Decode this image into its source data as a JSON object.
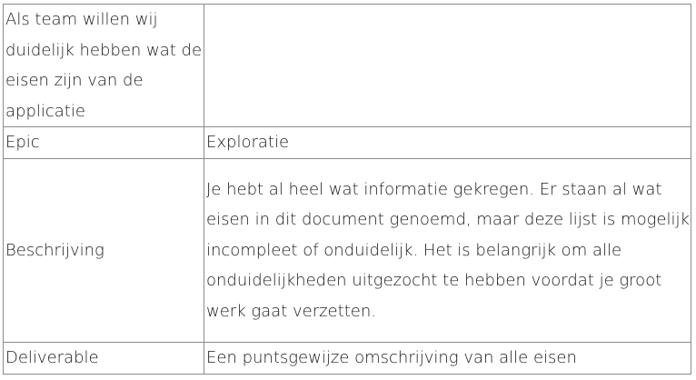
{
  "table": {
    "title_row": {
      "label": "Als team willen wij duidelijk hebben wat de eisen zijn van de applicatie",
      "value": ""
    },
    "epic_row": {
      "label": "Epic",
      "value": "Exploratie"
    },
    "description_row": {
      "label": "Beschrijving",
      "value": "Je hebt al heel wat informatie gekregen. Er staan al wat eisen in dit document genoemd, maar deze lijst is mogelijk incompleet of onduidelijk. Het is belangrijk om alle onduidelijkheden uitgezocht te hebben voordat je groot werk gaat verzetten."
    },
    "deliverable_row": {
      "label": "Deliverable",
      "value": "Een puntsgewijze omschrijving van alle eisen"
    }
  }
}
